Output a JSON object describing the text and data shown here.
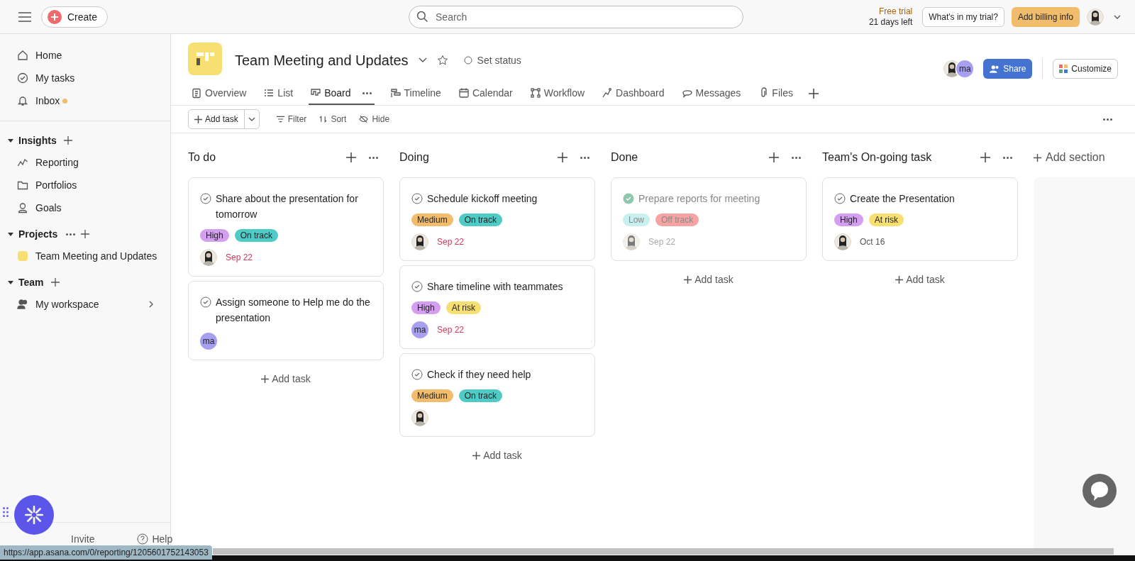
{
  "topbar": {
    "create_label": "Create",
    "search_placeholder": "Search",
    "trial_label": "Free trial",
    "trial_days": "21 days left",
    "trial_button": "What's in my trial?",
    "billing_button": "Add billing info"
  },
  "sidebar": {
    "nav": [
      {
        "label": "Home",
        "dot": false
      },
      {
        "label": "My tasks",
        "dot": false
      },
      {
        "label": "Inbox",
        "dot": true
      }
    ],
    "sections": [
      {
        "title": "Insights",
        "expanded": true,
        "items": [
          {
            "label": "Reporting"
          },
          {
            "label": "Portfolios"
          },
          {
            "label": "Goals"
          }
        ]
      },
      {
        "title": "Projects",
        "expanded": true,
        "items": [
          {
            "label": "Team Meeting and Updates",
            "color": "#f8df72"
          }
        ]
      },
      {
        "title": "Team",
        "expanded": true,
        "items": [
          {
            "label": "My workspace"
          }
        ]
      }
    ],
    "footer": {
      "invite": "Invite",
      "help": "Help"
    }
  },
  "project": {
    "title": "Team Meeting and Updates",
    "status": "Set status",
    "share": "Share",
    "customize": "Customize",
    "members": [
      {
        "kind": "photo"
      },
      {
        "kind": "initials",
        "initials": "ma"
      }
    ]
  },
  "tabs": [
    {
      "label": "Overview",
      "selected": false
    },
    {
      "label": "List",
      "selected": false
    },
    {
      "label": "Board",
      "selected": true
    },
    {
      "label": "Timeline",
      "selected": false
    },
    {
      "label": "Calendar",
      "selected": false
    },
    {
      "label": "Workflow",
      "selected": false
    },
    {
      "label": "Dashboard",
      "selected": false
    },
    {
      "label": "Messages",
      "selected": false
    },
    {
      "label": "Files",
      "selected": false
    }
  ],
  "toolbar": {
    "add_task": "Add task",
    "filter": "Filter",
    "sort": "Sort",
    "hide": "Hide"
  },
  "columns": [
    {
      "title": "To do",
      "add_task": "Add task",
      "tasks": [
        {
          "title": "Share about the presentation for tomorrow",
          "completed": false,
          "tags": [
            {
              "label": "High",
              "color": "#d59ff0"
            },
            {
              "label": "On track",
              "color": "#4ecbc4"
            }
          ],
          "assignee": {
            "kind": "photo"
          },
          "due": "Sep 22",
          "overdue": true
        },
        {
          "title": "Assign someone to Help me do the presentation",
          "completed": false,
          "assignee": {
            "kind": "initials",
            "initials": "ma"
          }
        }
      ]
    },
    {
      "title": "Doing",
      "add_task": "Add task",
      "tasks": [
        {
          "title": "Schedule kickoff meeting",
          "completed": false,
          "tags": [
            {
              "label": "Medium",
              "color": "#f1bd6c"
            },
            {
              "label": "On track",
              "color": "#4ecbc4"
            }
          ],
          "assignee": {
            "kind": "photo"
          },
          "due": "Sep 22",
          "overdue": true
        },
        {
          "title": "Share timeline with teammates",
          "completed": false,
          "tags": [
            {
              "label": "High",
              "color": "#d59ff0"
            },
            {
              "label": "At risk",
              "color": "#f8df72"
            }
          ],
          "assignee": {
            "kind": "initials",
            "initials": "ma"
          },
          "due": "Sep 22",
          "overdue": true
        },
        {
          "title": "Check if they need help",
          "completed": false,
          "tags": [
            {
              "label": "Medium",
              "color": "#f1bd6c"
            },
            {
              "label": "On track",
              "color": "#4ecbc4"
            }
          ],
          "assignee": {
            "kind": "photo"
          }
        }
      ]
    },
    {
      "title": "Done",
      "add_task": "Add task",
      "tasks": [
        {
          "title": "Prepare reports for meeting",
          "completed": true,
          "tags": [
            {
              "label": "Low",
              "color": "#c7f0ee"
            },
            {
              "label": "Off track",
              "color": "#f5a3a3"
            }
          ],
          "assignee": {
            "kind": "photo"
          },
          "due": "Sep 22",
          "overdue": false
        }
      ]
    },
    {
      "title": "Team's On-going task",
      "add_task": "Add task",
      "tasks": [
        {
          "title": "Create the Presentation",
          "completed": false,
          "tags": [
            {
              "label": "High",
              "color": "#d59ff0"
            },
            {
              "label": "At risk",
              "color": "#f8df72"
            }
          ],
          "assignee": {
            "kind": "photo"
          },
          "due": "Oct 16",
          "overdue": false
        }
      ]
    }
  ],
  "add_section": "Add section",
  "status_url": "https://app.asana.com/0/reporting/1205601752143053"
}
